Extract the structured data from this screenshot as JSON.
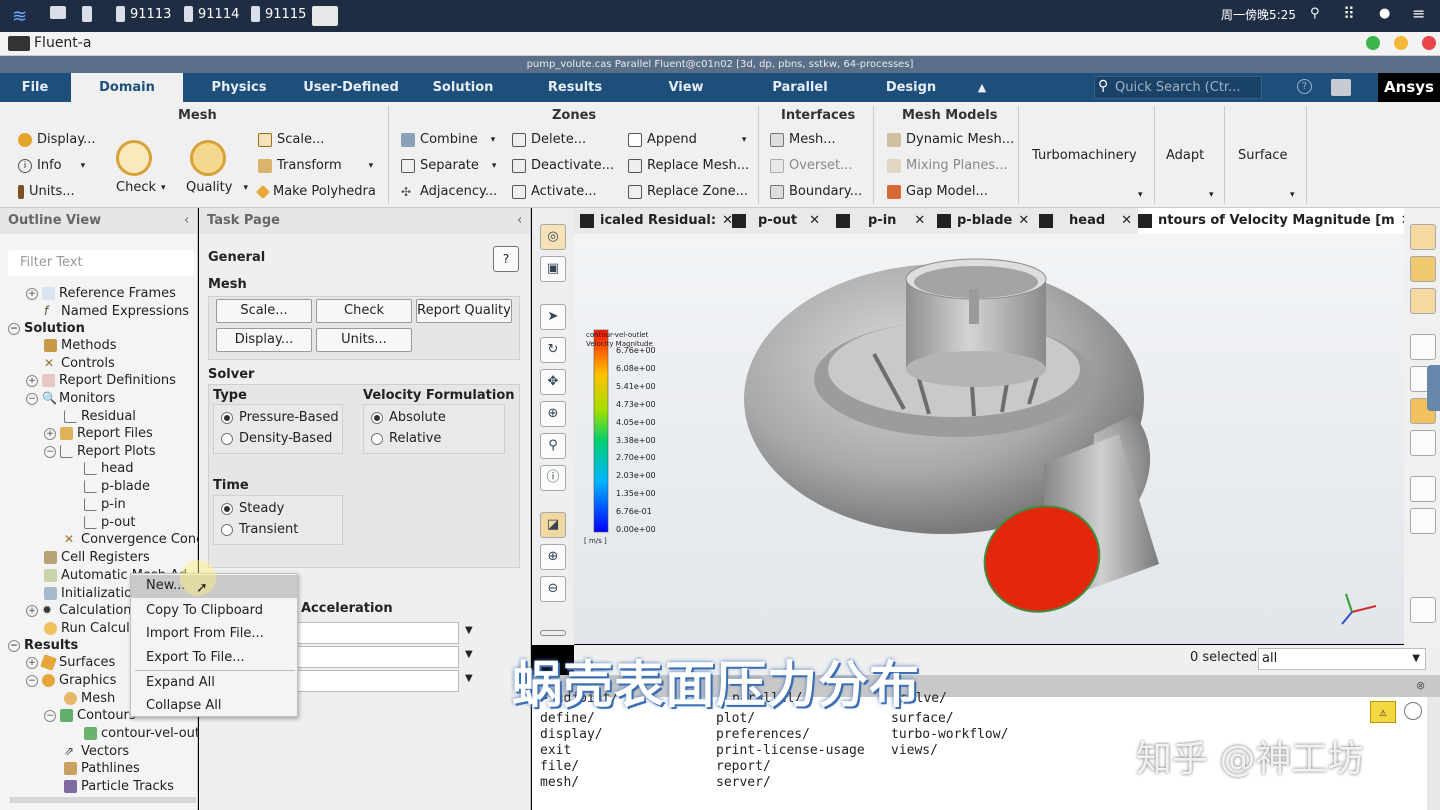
{
  "taskbar": {
    "items": [
      "91113",
      "91114",
      "91115"
    ],
    "clock": "周一傍晚5:25"
  },
  "window": {
    "app_title": "Fluent-a",
    "header": "pump_volute.cas Parallel Fluent@c01n02  [3d, dp, pbns, sstkw, 64-processes]"
  },
  "menu": {
    "tabs": [
      "File",
      "Domain",
      "Physics",
      "User-Defined",
      "Solution",
      "Results",
      "View",
      "Parallel",
      "Design"
    ],
    "active": "Domain",
    "search_placeholder": "Quick Search (Ctr...",
    "brand": "Ansys"
  },
  "ribbon": {
    "mesh": {
      "title": "Mesh",
      "display": "Display...",
      "info": "Info",
      "units": "Units...",
      "check": "Check",
      "quality": "Quality",
      "scale": "Scale...",
      "transform": "Transform",
      "make_polyhedra": "Make Polyhedra"
    },
    "zones": {
      "title": "Zones",
      "combine": "Combine",
      "separate": "Separate",
      "adjacency": "Adjacency...",
      "delete": "Delete...",
      "deactivate": "Deactivate...",
      "activate": "Activate...",
      "append": "Append",
      "replace_mesh": "Replace Mesh...",
      "replace_zone": "Replace Zone..."
    },
    "interfaces": {
      "title": "Interfaces",
      "mesh": "Mesh...",
      "overset": "Overset...",
      "boundary": "Boundary..."
    },
    "mesh_models": {
      "title": "Mesh Models",
      "dynamic_mesh": "Dynamic Mesh...",
      "mixing_planes": "Mixing Planes...",
      "gap_model": "Gap Model..."
    },
    "turbomachinery": "Turbomachinery",
    "adapt": "Adapt",
    "surface": "Surface"
  },
  "outline": {
    "title": "Outline View",
    "filter_placeholder": "Filter Text",
    "items": [
      "Reference Frames",
      "Named Expressions",
      "Solution",
      "Methods",
      "Controls",
      "Report Definitions",
      "Monitors",
      "Residual",
      "Report Files",
      "Report Plots",
      "head",
      "p-blade",
      "p-in",
      "p-out",
      "Convergence Conc",
      "Cell Registers",
      "Automatic Mesh Ad",
      "Initialization",
      "Calculation",
      "Run Calcul",
      "Results",
      "Surfaces",
      "Graphics",
      "Mesh",
      "Contours",
      "contour-vel-out",
      "Vectors",
      "Pathlines",
      "Particle Tracks"
    ]
  },
  "context_menu": [
    "New...",
    "Copy To Clipboard",
    "Import From File...",
    "Export To File...",
    "Expand All",
    "Collapse All"
  ],
  "task": {
    "title": "Task Page",
    "section": "General",
    "mesh_label": "Mesh",
    "scale": "Scale...",
    "check": "Check",
    "report_quality": "Report Quality",
    "display": "Display...",
    "units": "Units...",
    "solver": "Solver",
    "type": "Type",
    "pressure_based": "Pressure-Based",
    "density_based": "Density-Based",
    "velocity_formulation": "Velocity Formulation",
    "absolute": "Absolute",
    "relative": "Relative",
    "time": "Time",
    "steady": "Steady",
    "transient": "Transient",
    "acceleration": "Acceleration"
  },
  "graphics": {
    "tabs": [
      "icaled Residual:",
      "p-out",
      "p-in",
      "p-blade",
      "head",
      "ntours of Velocity Magnitude [m"
    ],
    "legend": {
      "title1": "contour-vel-outlet",
      "title2": "Velocity Magnitude",
      "values": [
        "6.76e+00",
        "6.08e+00",
        "5.41e+00",
        "4.73e+00",
        "4.05e+00",
        "3.38e+00",
        "2.70e+00",
        "2.03e+00",
        "1.35e+00",
        "6.76e-01",
        "0.00e+00"
      ],
      "unit": "[ m/s ]"
    },
    "selected": "0 selected",
    "filter": "all"
  },
  "console": {
    "lines": [
      [
        "> adjoint/",
        "parallel/",
        "solve/"
      ],
      [
        "define/",
        "plot/",
        "surface/"
      ],
      [
        "display/",
        "preferences/",
        "turbo-workflow/"
      ],
      [
        "exit",
        "print-license-usage",
        "views/"
      ],
      [
        "file/",
        "report/",
        ""
      ],
      [
        "mesh/",
        "server/",
        ""
      ]
    ]
  },
  "overlay": {
    "subtitle": "蜗壳表面压力分布",
    "watermark": "知乎 @神工坊"
  }
}
